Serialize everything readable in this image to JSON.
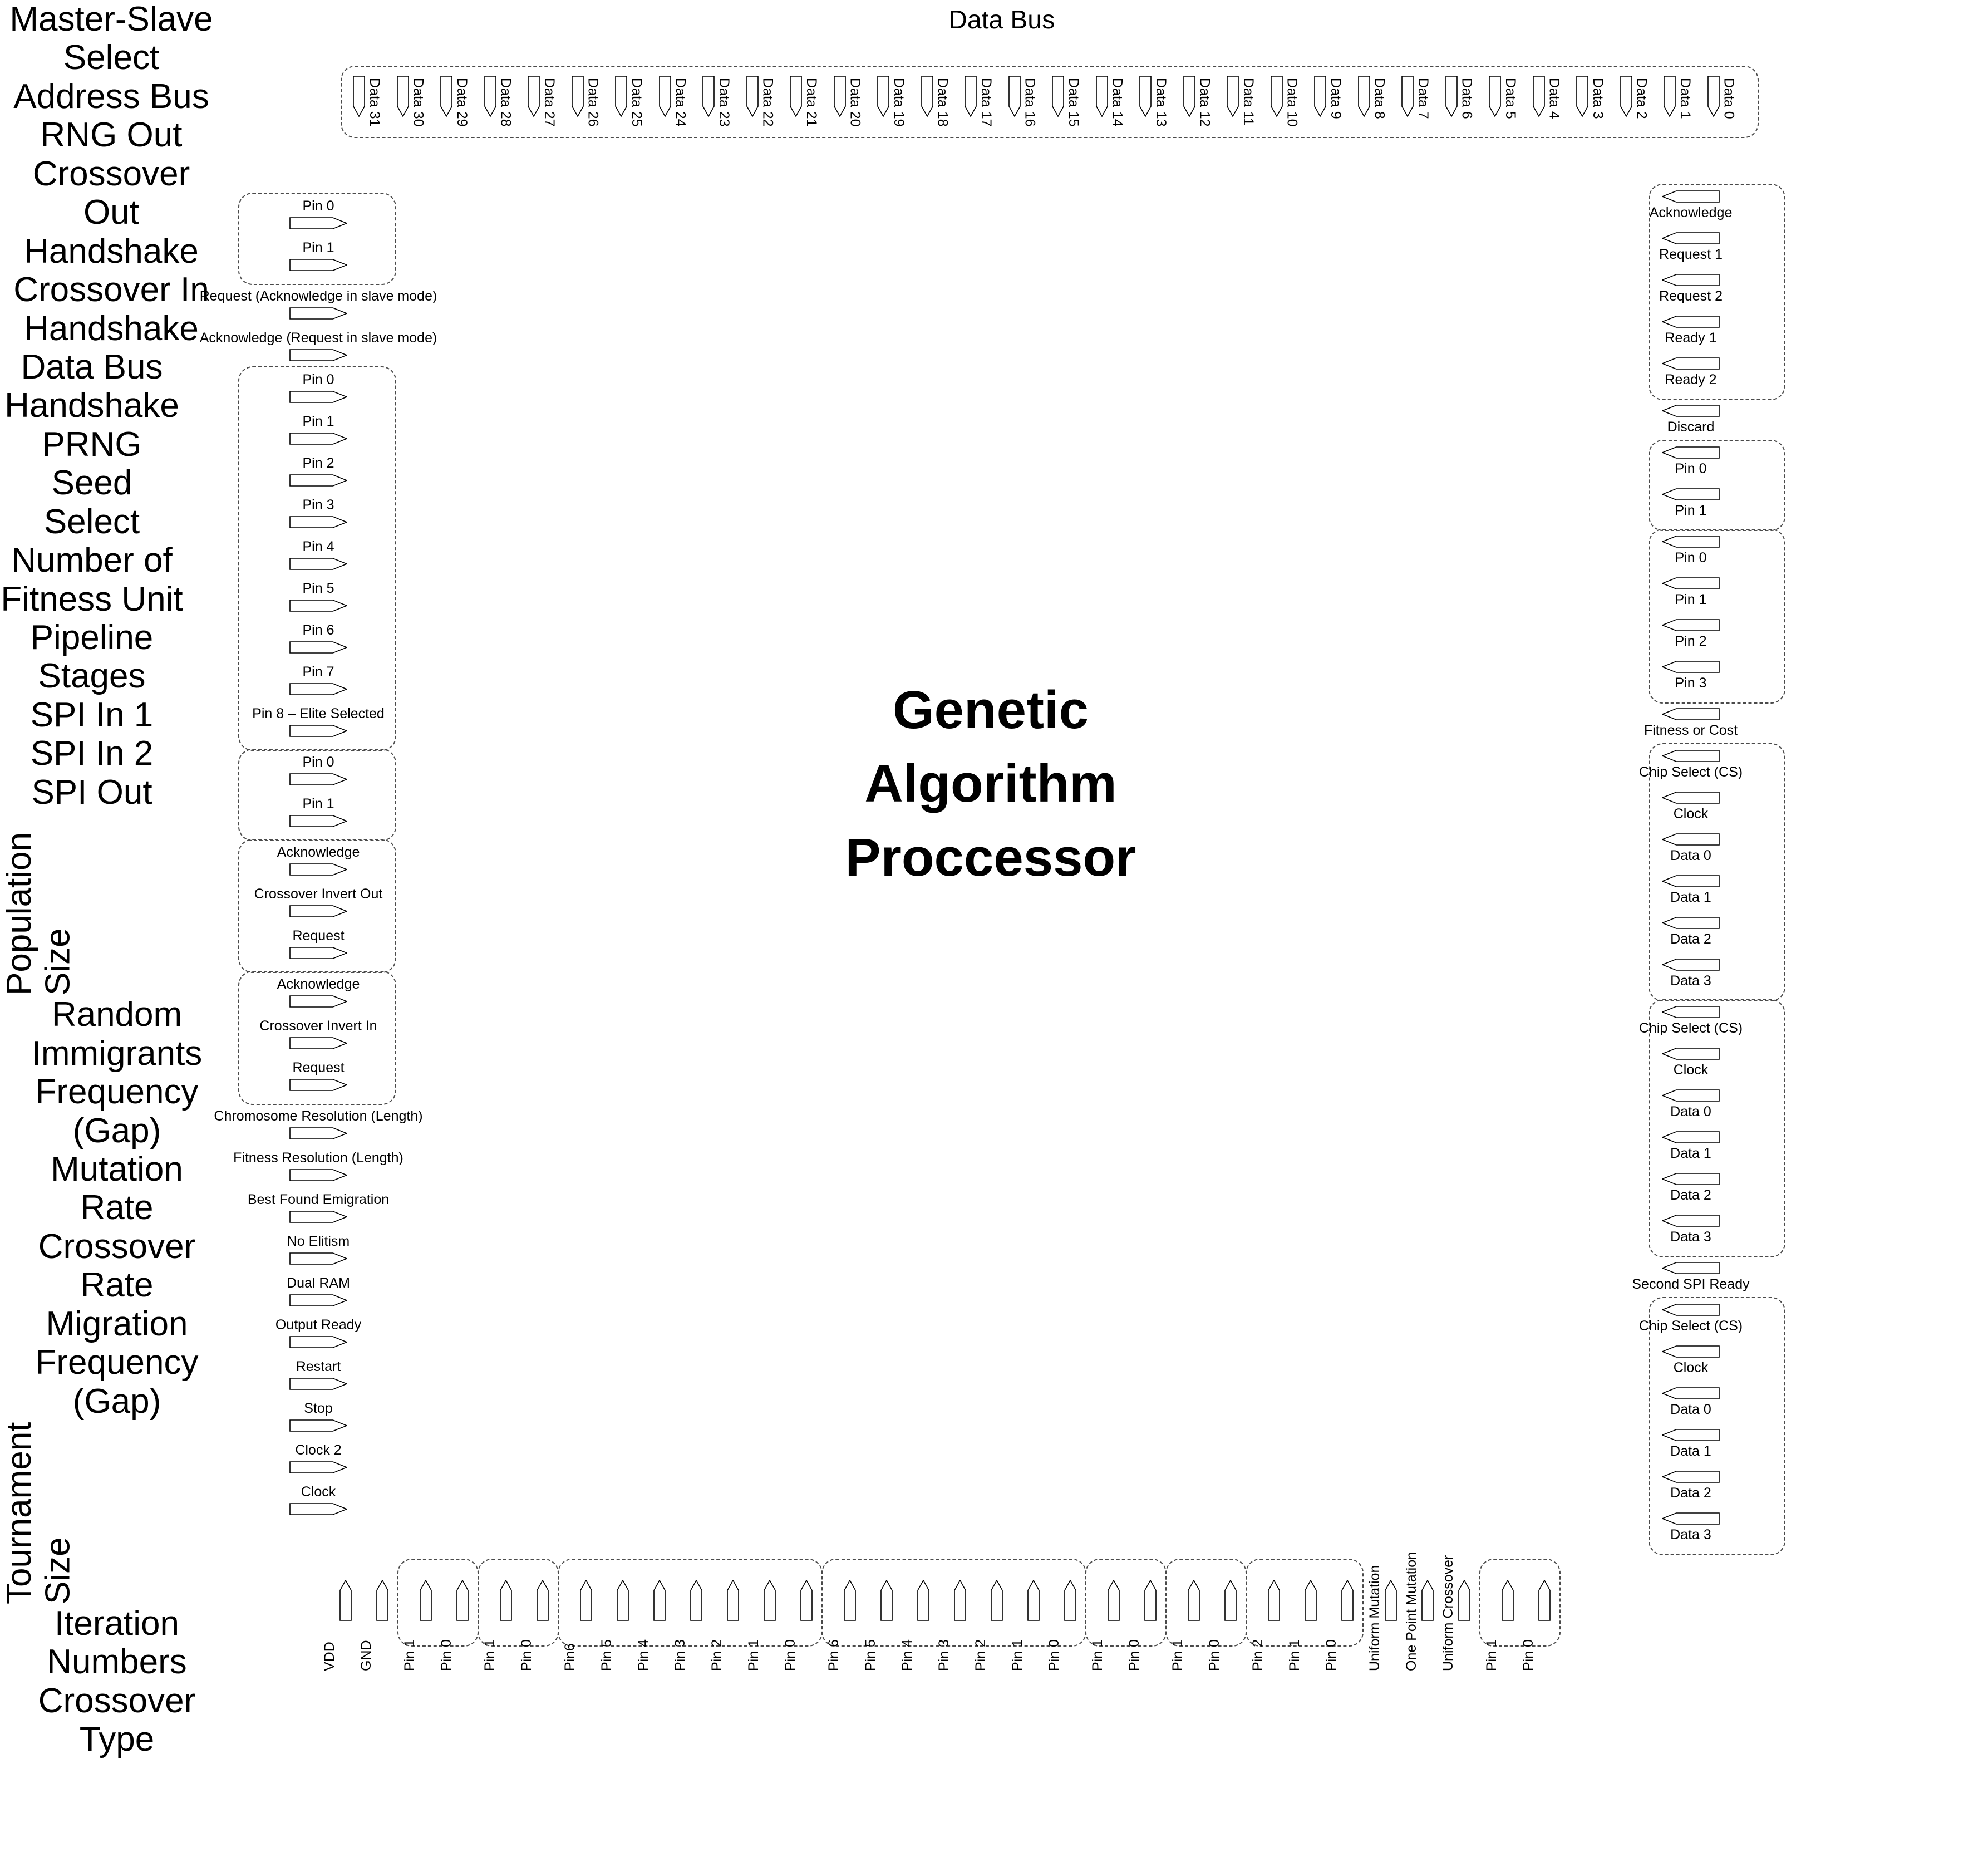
{
  "title": "Genetic\nAlgorithm\nProccessor",
  "colors": {
    "ink": "#000000",
    "dash": "#4a4a4a",
    "background": "#ffffff"
  },
  "top": {
    "group_label": "Data Bus",
    "pins": [
      "Data 31",
      "Data 30",
      "Data 29",
      "Data 28",
      "Data 27",
      "Data 26",
      "Data 25",
      "Data 24",
      "Data 23",
      "Data 22",
      "Data 21",
      "Data 20",
      "Data 19",
      "Data 18",
      "Data 17",
      "Data 16",
      "Data 15",
      "Data 14",
      "Data 13",
      "Data 12",
      "Data 11",
      "Data 10",
      "Data 9",
      "Data 8",
      "Data 7",
      "Data 6",
      "Data 5",
      "Data 4",
      "Data 3",
      "Data 2",
      "Data 1",
      "Data 0"
    ]
  },
  "left": {
    "groups": [
      {
        "label": "Master-Slave\nSelect",
        "boxed": true,
        "pins": [
          "Pin 0",
          "Pin 1"
        ]
      },
      {
        "label": "",
        "boxed": false,
        "pins": [
          "Request (Acknowledge in slave mode)",
          "Acknowledge (Request in slave mode)"
        ]
      },
      {
        "label": "Address Bus",
        "boxed": true,
        "pins": [
          "Pin 0",
          "Pin 1",
          "Pin 2",
          "Pin 3",
          "Pin 4",
          "Pin 5",
          "Pin 6",
          "Pin 7",
          "Pin 8 – Elite Selected"
        ]
      },
      {
        "label": "RNG Out",
        "boxed": true,
        "pins": [
          "Pin 0",
          "Pin 1"
        ]
      },
      {
        "label": "Crossover\nOut\nHandshake",
        "boxed": true,
        "pins": [
          "Acknowledge",
          "Crossover Invert Out",
          "Request"
        ]
      },
      {
        "label": "Crossover In\nHandshake",
        "boxed": true,
        "pins": [
          "Acknowledge",
          "Crossover Invert In",
          "Request"
        ]
      },
      {
        "label": "",
        "boxed": false,
        "pins": [
          "Chromosome Resolution (Length)",
          "Fitness Resolution (Length)",
          "Best Found Emigration",
          "No Elitism",
          "Dual RAM",
          "Output Ready",
          "Restart",
          "Stop",
          "Clock 2",
          "Clock"
        ]
      }
    ]
  },
  "right": {
    "groups": [
      {
        "label": "Data Bus\nHandshake",
        "boxed": true,
        "pins": [
          "Acknowledge",
          "Request 1",
          "Request 2",
          "Ready 1",
          "Ready 2"
        ]
      },
      {
        "label": "",
        "boxed": false,
        "pins": [
          "Discard"
        ]
      },
      {
        "label": "PRNG Seed\nSelect",
        "boxed": true,
        "pins": [
          "Pin 0",
          "Pin 1"
        ]
      },
      {
        "label": "Number of\nFitness Unit\nPipeline Stages",
        "boxed": true,
        "pins": [
          "Pin 0",
          "Pin 1",
          "Pin 2",
          "Pin 3"
        ]
      },
      {
        "label": "",
        "boxed": false,
        "pins": [
          "Fitness or Cost"
        ]
      },
      {
        "label": "SPI In 1",
        "boxed": true,
        "pins": [
          "Chip Select (CS)",
          "Clock",
          "Data 0",
          "Data 1",
          "Data 2",
          "Data 3"
        ]
      },
      {
        "label": "SPI In 2",
        "boxed": true,
        "pins": [
          "Chip Select (CS)",
          "Clock",
          "Data 0",
          "Data 1",
          "Data 2",
          "Data 3"
        ]
      },
      {
        "label": "",
        "boxed": false,
        "pins": [
          "Second SPI Ready"
        ]
      },
      {
        "label": "SPI Out",
        "boxed": true,
        "pins": [
          "Chip Select (CS)",
          "Clock",
          "Data 0",
          "Data 1",
          "Data 2",
          "Data 3"
        ]
      }
    ]
  },
  "bottom": {
    "groups": [
      {
        "label": "",
        "boxed": false,
        "pins": [
          "VDD",
          "GND"
        ]
      },
      {
        "label": "Population\nSize",
        "boxed": true,
        "pins": [
          "Pin 1",
          "Pin 0"
        ]
      },
      {
        "label": "Random\nImmigrants\nFrequency\n(Gap)",
        "boxed": true,
        "pins": [
          "Pin 1",
          "Pin 0"
        ]
      },
      {
        "label": "Mutation\nRate",
        "boxed": true,
        "pins": [
          "Pin6",
          "Pin 5",
          "Pin 4",
          "Pin 3",
          "Pin 2",
          "Pin 1",
          "Pin 0"
        ]
      },
      {
        "label": "Crossover\nRate",
        "boxed": true,
        "pins": [
          "Pin 6",
          "Pin 5",
          "Pin 4",
          "Pin 3",
          "Pin 2",
          "Pin 1",
          "Pin 0"
        ]
      },
      {
        "label": "Migration\nFrequency\n(Gap)",
        "boxed": true,
        "pins": [
          "Pin 1",
          "Pin 0"
        ]
      },
      {
        "label": "Tournament\nSize",
        "boxed": true,
        "pins": [
          "Pin 1",
          "Pin 0"
        ]
      },
      {
        "label": "Iteration\nNumbers",
        "boxed": true,
        "pins": [
          "Pin 2",
          "Pin 1",
          "Pin 0"
        ]
      },
      {
        "label": "",
        "boxed": false,
        "pins": [
          "Uniform Mutation",
          "One Point Mutation",
          "Uniform Crossover"
        ]
      },
      {
        "label": "Crossover\nType",
        "boxed": true,
        "pins": [
          "Pin 1",
          "Pin 0"
        ]
      }
    ]
  }
}
